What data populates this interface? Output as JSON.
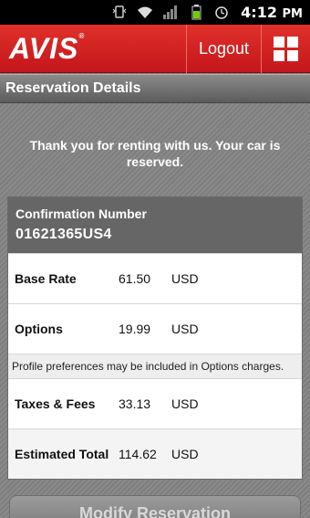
{
  "status_bar": {
    "time": "4:12",
    "time_suffix": "PM",
    "icons": [
      "vibrate-icon",
      "wifi-icon",
      "signal-icon",
      "battery-icon",
      "alarm-icon"
    ]
  },
  "header": {
    "logo": "AVIS",
    "logout_label": "Logout",
    "menu_icon": "grid-icon",
    "brand_color": "#c4161c"
  },
  "section": {
    "title": "Reservation Details"
  },
  "message": "Thank you for renting with us. Your car is reserved.",
  "confirmation": {
    "label": "Confirmation Number",
    "number": "01621365US4"
  },
  "rates": [
    {
      "name": "Base Rate",
      "value": "61.50",
      "currency": "USD"
    },
    {
      "name": "Options",
      "value": "19.99",
      "currency": "USD"
    }
  ],
  "note": "Profile preferences may be included in Options charges.",
  "rates2": [
    {
      "name": "Taxes & Fees",
      "value": "33.13",
      "currency": "USD"
    },
    {
      "name": "Estimated Total",
      "value": "114.62",
      "currency": "USD"
    }
  ],
  "modify_button": "Modify Reservation"
}
